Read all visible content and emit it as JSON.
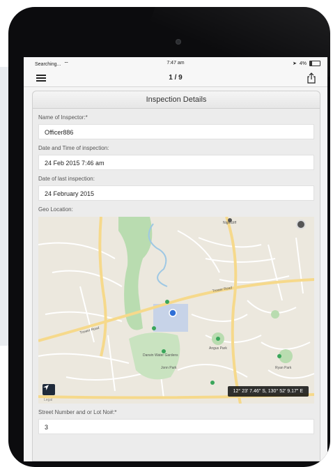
{
  "status_bar": {
    "carrier": "Searching...",
    "time": "7:47 am",
    "battery": "4%"
  },
  "nav": {
    "page_counter": "1 / 9",
    "menu_icon": "hamburger-menu-icon",
    "share_icon": "share-icon"
  },
  "form": {
    "header": "Inspection Details",
    "inspector_label": "Name of Inspector:*",
    "inspector_value": "Officer886",
    "datetime_label": "Date and Time of inspection:",
    "datetime_value": "24 Feb 2015 7:46 am",
    "last_inspection_label": "Date of last inspection:",
    "last_inspection_value": "24 February 2015",
    "geo_label": "Geo Location:",
    "street_label": "Street Number and or Lot No#:*",
    "street_value": "3"
  },
  "map": {
    "coordinates": "12° 23' 7.46\" S, 130° 52' 9.17\" E",
    "legal": "Legal",
    "locate_icon": "location-arrow-icon",
    "pin_color": "#2f6fd6"
  },
  "colors": {
    "frame": "#0c0c0e",
    "park": "#b9dcb0",
    "road": "#f6d98b",
    "water": "#9ec8e4"
  }
}
